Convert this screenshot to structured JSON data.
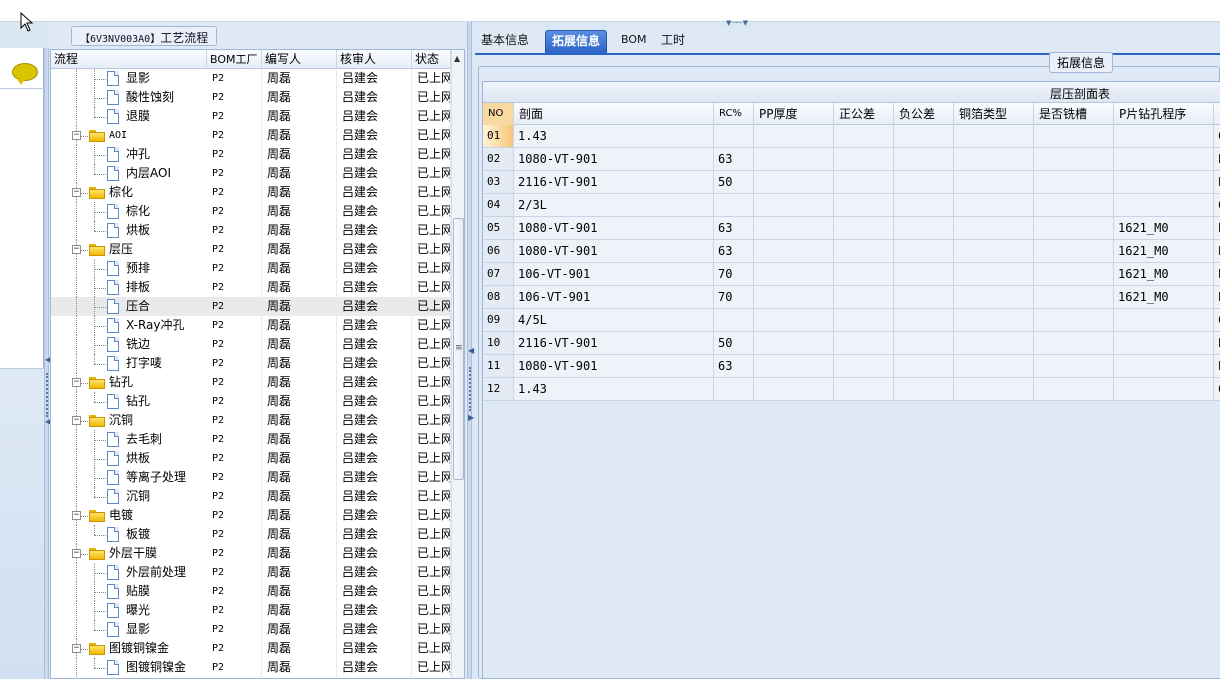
{
  "left_panel": {
    "title_code": "【6V3NV003A0】",
    "title_text": "工艺流程",
    "columns": [
      "流程",
      "BOM工厂",
      "编写人",
      "核审人",
      "状态"
    ],
    "rows": [
      {
        "level": 2,
        "type": "leaf",
        "name": "显影",
        "bom": "P2",
        "writer": "周磊",
        "reviewer": "吕建会",
        "status": "已上网"
      },
      {
        "level": 2,
        "type": "leaf",
        "name": "酸性蚀刻",
        "bom": "P2",
        "writer": "周磊",
        "reviewer": "吕建会",
        "status": "已上网"
      },
      {
        "level": 2,
        "type": "leaf",
        "name": "退膜",
        "bom": "P2",
        "writer": "周磊",
        "reviewer": "吕建会",
        "status": "已上网"
      },
      {
        "level": 1,
        "type": "folder",
        "name": "AOI",
        "bom": "P2",
        "writer": "周磊",
        "reviewer": "吕建会",
        "status": "已上网"
      },
      {
        "level": 2,
        "type": "leaf",
        "name": "冲孔",
        "bom": "P2",
        "writer": "周磊",
        "reviewer": "吕建会",
        "status": "已上网"
      },
      {
        "level": 2,
        "type": "leaf",
        "name": "内层AOI",
        "bom": "P2",
        "writer": "周磊",
        "reviewer": "吕建会",
        "status": "已上网"
      },
      {
        "level": 1,
        "type": "folder",
        "name": "棕化",
        "bom": "P2",
        "writer": "周磊",
        "reviewer": "吕建会",
        "status": "已上网"
      },
      {
        "level": 2,
        "type": "leaf",
        "name": "棕化",
        "bom": "P2",
        "writer": "周磊",
        "reviewer": "吕建会",
        "status": "已上网"
      },
      {
        "level": 2,
        "type": "leaf",
        "name": "烘板",
        "bom": "P2",
        "writer": "周磊",
        "reviewer": "吕建会",
        "status": "已上网"
      },
      {
        "level": 1,
        "type": "folder",
        "name": "层压",
        "bom": "P2",
        "writer": "周磊",
        "reviewer": "吕建会",
        "status": "已上网"
      },
      {
        "level": 2,
        "type": "leaf",
        "name": "预排",
        "bom": "P2",
        "writer": "周磊",
        "reviewer": "吕建会",
        "status": "已上网"
      },
      {
        "level": 2,
        "type": "leaf",
        "name": "排板",
        "bom": "P2",
        "writer": "周磊",
        "reviewer": "吕建会",
        "status": "已上网"
      },
      {
        "level": 2,
        "type": "leaf",
        "name": "压合",
        "bom": "P2",
        "writer": "周磊",
        "reviewer": "吕建会",
        "status": "已上网",
        "selected": true
      },
      {
        "level": 2,
        "type": "leaf",
        "name": "X-Ray冲孔",
        "bom": "P2",
        "writer": "周磊",
        "reviewer": "吕建会",
        "status": "已上网"
      },
      {
        "level": 2,
        "type": "leaf",
        "name": "铣边",
        "bom": "P2",
        "writer": "周磊",
        "reviewer": "吕建会",
        "status": "已上网"
      },
      {
        "level": 2,
        "type": "leaf",
        "name": "打字唛",
        "bom": "P2",
        "writer": "周磊",
        "reviewer": "吕建会",
        "status": "已上网"
      },
      {
        "level": 1,
        "type": "folder",
        "name": "钻孔",
        "bom": "P2",
        "writer": "周磊",
        "reviewer": "吕建会",
        "status": "已上网"
      },
      {
        "level": 2,
        "type": "leaf",
        "name": "钻孔",
        "bom": "P2",
        "writer": "周磊",
        "reviewer": "吕建会",
        "status": "已上网"
      },
      {
        "level": 1,
        "type": "folder",
        "name": "沉铜",
        "bom": "P2",
        "writer": "周磊",
        "reviewer": "吕建会",
        "status": "已上网"
      },
      {
        "level": 2,
        "type": "leaf",
        "name": "去毛刺",
        "bom": "P2",
        "writer": "周磊",
        "reviewer": "吕建会",
        "status": "已上网"
      },
      {
        "level": 2,
        "type": "leaf",
        "name": "烘板",
        "bom": "P2",
        "writer": "周磊",
        "reviewer": "吕建会",
        "status": "已上网"
      },
      {
        "level": 2,
        "type": "leaf",
        "name": "等离子处理",
        "bom": "P2",
        "writer": "周磊",
        "reviewer": "吕建会",
        "status": "已上网"
      },
      {
        "level": 2,
        "type": "leaf",
        "name": "沉铜",
        "bom": "P2",
        "writer": "周磊",
        "reviewer": "吕建会",
        "status": "已上网"
      },
      {
        "level": 1,
        "type": "folder",
        "name": "电镀",
        "bom": "P2",
        "writer": "周磊",
        "reviewer": "吕建会",
        "status": "已上网"
      },
      {
        "level": 2,
        "type": "leaf",
        "name": "板镀",
        "bom": "P2",
        "writer": "周磊",
        "reviewer": "吕建会",
        "status": "已上网"
      },
      {
        "level": 1,
        "type": "folder",
        "name": "外层干膜",
        "bom": "P2",
        "writer": "周磊",
        "reviewer": "吕建会",
        "status": "已上网"
      },
      {
        "level": 2,
        "type": "leaf",
        "name": "外层前处理",
        "bom": "P2",
        "writer": "周磊",
        "reviewer": "吕建会",
        "status": "已上网"
      },
      {
        "level": 2,
        "type": "leaf",
        "name": "贴膜",
        "bom": "P2",
        "writer": "周磊",
        "reviewer": "吕建会",
        "status": "已上网"
      },
      {
        "level": 2,
        "type": "leaf",
        "name": "曝光",
        "bom": "P2",
        "writer": "周磊",
        "reviewer": "吕建会",
        "status": "已上网"
      },
      {
        "level": 2,
        "type": "leaf",
        "name": "显影",
        "bom": "P2",
        "writer": "周磊",
        "reviewer": "吕建会",
        "status": "已上网"
      },
      {
        "level": 1,
        "type": "folder",
        "name": "图镀铜镍金",
        "bom": "P2",
        "writer": "周磊",
        "reviewer": "吕建会",
        "status": "已上网"
      },
      {
        "level": 2,
        "type": "leaf",
        "name": "图镀铜镍金",
        "bom": "P2",
        "writer": "周磊",
        "reviewer": "吕建会",
        "status": "已上网"
      }
    ]
  },
  "tabs": [
    {
      "label": "基本信息",
      "active": false
    },
    {
      "label": "拓展信息",
      "active": true
    },
    {
      "label": "BOM",
      "active": false
    },
    {
      "label": "工时",
      "active": false
    }
  ],
  "extended": {
    "legend": "拓展信息",
    "grid_title": "层压剖面表",
    "columns": [
      "NO",
      "剖面",
      "RC%",
      "PP厚度",
      "正公差",
      "负公差",
      "铜箔类型",
      "是否铣槽",
      "P片钻孔程序"
    ],
    "rows": [
      {
        "no": "01",
        "profile": "1.43",
        "rc": "",
        "pp": "",
        "pos": "",
        "neg": "",
        "foil": "",
        "slot": "",
        "drill": "",
        "extra": "C",
        "selected": true
      },
      {
        "no": "02",
        "profile": "1080-VT-901",
        "rc": "63",
        "pp": "",
        "pos": "",
        "neg": "",
        "foil": "",
        "slot": "",
        "drill": "",
        "extra": "P"
      },
      {
        "no": "03",
        "profile": "2116-VT-901",
        "rc": "50",
        "pp": "",
        "pos": "",
        "neg": "",
        "foil": "",
        "slot": "",
        "drill": "",
        "extra": "P"
      },
      {
        "no": "04",
        "profile": "2/3L",
        "rc": "",
        "pp": "",
        "pos": "",
        "neg": "",
        "foil": "",
        "slot": "",
        "drill": "",
        "extra": "C"
      },
      {
        "no": "05",
        "profile": "1080-VT-901",
        "rc": "63",
        "pp": "",
        "pos": "",
        "neg": "",
        "foil": "",
        "slot": "",
        "drill": "1621_M0",
        "extra": "P"
      },
      {
        "no": "06",
        "profile": "1080-VT-901",
        "rc": "63",
        "pp": "",
        "pos": "",
        "neg": "",
        "foil": "",
        "slot": "",
        "drill": "1621_M0",
        "extra": "P"
      },
      {
        "no": "07",
        "profile": "106-VT-901",
        "rc": "70",
        "pp": "",
        "pos": "",
        "neg": "",
        "foil": "",
        "slot": "",
        "drill": "1621_M0",
        "extra": "P"
      },
      {
        "no": "08",
        "profile": "106-VT-901",
        "rc": "70",
        "pp": "",
        "pos": "",
        "neg": "",
        "foil": "",
        "slot": "",
        "drill": "1621_M0",
        "extra": "P"
      },
      {
        "no": "09",
        "profile": "4/5L",
        "rc": "",
        "pp": "",
        "pos": "",
        "neg": "",
        "foil": "",
        "slot": "",
        "drill": "",
        "extra": "C"
      },
      {
        "no": "10",
        "profile": "2116-VT-901",
        "rc": "50",
        "pp": "",
        "pos": "",
        "neg": "",
        "foil": "",
        "slot": "",
        "drill": "",
        "extra": "P"
      },
      {
        "no": "11",
        "profile": "1080-VT-901",
        "rc": "63",
        "pp": "",
        "pos": "",
        "neg": "",
        "foil": "",
        "slot": "",
        "drill": "",
        "extra": "P"
      },
      {
        "no": "12",
        "profile": "1.43",
        "rc": "",
        "pp": "",
        "pos": "",
        "neg": "",
        "foil": "",
        "slot": "",
        "drill": "",
        "extra": "C"
      }
    ]
  },
  "icons": {
    "chat": "speech-bubble-icon",
    "folder": "folder-icon",
    "document": "document-icon"
  },
  "colors": {
    "active_tab": "#2d64c8",
    "panel_bg": "#dfe9f6",
    "folder": "#f0b800"
  }
}
